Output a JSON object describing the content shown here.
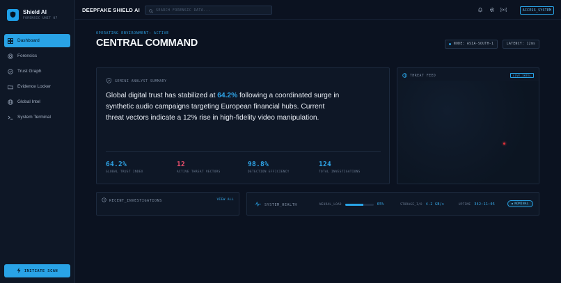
{
  "brand": {
    "title": "Shield AI",
    "subtitle": "FORENSIC UNIT 07"
  },
  "sidebar": {
    "items": [
      {
        "label": "Dashboard",
        "icon": "dashboard-icon",
        "active": true
      },
      {
        "label": "Forensics",
        "icon": "fingerprint-icon",
        "active": false
      },
      {
        "label": "Trust Graph",
        "icon": "graph-icon",
        "active": false
      },
      {
        "label": "Evidence Locker",
        "icon": "folder-icon",
        "active": false
      },
      {
        "label": "Global Intel",
        "icon": "globe-icon",
        "active": false
      },
      {
        "label": "System Terminal",
        "icon": "terminal-icon",
        "active": false
      }
    ],
    "scan_label": "INITIATE SCAN"
  },
  "topbar": {
    "title": "DEEPFAKE SHIELD AI",
    "search_placeholder": "SEARCH FORENSIC DATA...",
    "icons": [
      "bell-icon",
      "gear-icon",
      "broadcast-icon"
    ],
    "access_label": "ACCESS_SYSTEM"
  },
  "header": {
    "environment": "OPERATING ENVIRONMENT: ACTIVE",
    "title": "CENTRAL COMMAND",
    "node": "NODE: ASIA-SOUTH-1",
    "latency": "LATENCY: 12ms"
  },
  "summary": {
    "label": "GEMINI ANALYST SUMMARY",
    "text_before": "Global digital trust has stabilized at ",
    "highlight": "64.2%",
    "text_after": " following a coordinated surge in synthetic audio campaigns targeting European financial hubs. Current threat vectors indicate a 12% rise in high-fidelity video manipulation.",
    "stats": [
      {
        "value": "64.2%",
        "label": "GLOBAL TRUST INDEX",
        "color": "#2fa6ea"
      },
      {
        "value": "12",
        "label": "ACTIVE THREAT VECTORS",
        "color": "#f0506e"
      },
      {
        "value": "98.8%",
        "label": "DETECTION EFFICIENCY",
        "color": "#2fa6ea"
      },
      {
        "value": "124",
        "label": "TOTAL INVESTIGATIONS",
        "color": "#2fa6ea"
      }
    ]
  },
  "threat_feed": {
    "label": "THREAT FEED",
    "badge": "LIVE_INTEL"
  },
  "recent": {
    "label": "RECENT_INVESTIGATIONS",
    "view_all": "VIEW ALL"
  },
  "health": {
    "label": "SYSTEM_HEALTH",
    "neural_load_label": "NEURAL_LOAD",
    "neural_load_value": "65%",
    "neural_load_fraction": 0.65,
    "storage_label": "STORAGE_I/O",
    "storage_value": "4.2 GB/s",
    "uptime_label": "UPTIME",
    "uptime_value": "342:11:05",
    "status": "NOMINAL"
  },
  "colors": {
    "accent": "#29a3e6",
    "danger": "#f0506e",
    "background": "#0b1220"
  }
}
